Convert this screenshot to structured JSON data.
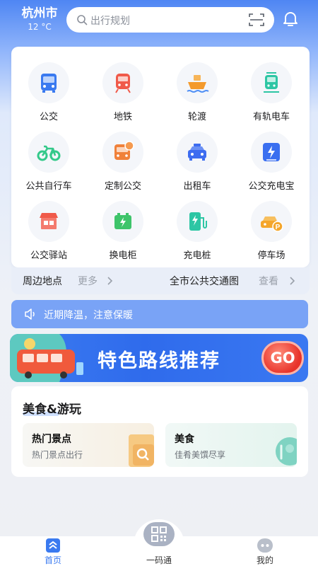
{
  "header": {
    "city": "杭州市",
    "temperature": "12 °C",
    "search_placeholder": "出行规划"
  },
  "grid": [
    {
      "label": "公交",
      "icon": "bus-icon",
      "color": "#3a7af0"
    },
    {
      "label": "地铁",
      "icon": "metro-icon",
      "color": "#f05a4a"
    },
    {
      "label": "轮渡",
      "icon": "ferry-icon",
      "color": "#f49a2c"
    },
    {
      "label": "有轨电车",
      "icon": "tram-icon",
      "color": "#2dc6a4"
    },
    {
      "label": "公共自行车",
      "icon": "bicycle-icon",
      "color": "#34c98a"
    },
    {
      "label": "定制公交",
      "icon": "custom-bus-icon",
      "color": "#f0813a"
    },
    {
      "label": "出租车",
      "icon": "taxi-icon",
      "color": "#3d6cf0"
    },
    {
      "label": "公交充电宝",
      "icon": "power-bank-icon",
      "color": "#3a6ff0"
    },
    {
      "label": "公交驿站",
      "icon": "bus-station-icon",
      "color": "#f05a4a"
    },
    {
      "label": "换电柜",
      "icon": "battery-swap-icon",
      "color": "#3ec46a"
    },
    {
      "label": "充电桩",
      "icon": "charging-pile-icon",
      "color": "#2dc6a4"
    },
    {
      "label": "停车场",
      "icon": "parking-icon",
      "color": "#f4a62c"
    }
  ],
  "nearby": {
    "title": "周边地点",
    "more": "更多",
    "map_title": "全市公共交通图",
    "map_view": "查看"
  },
  "notice": {
    "text": "近期降温，注意保暖"
  },
  "banner": {
    "title": "特色路线推荐",
    "go": "GO"
  },
  "fun": {
    "title": "美食&游玩",
    "tiles": [
      {
        "title": "热门景点",
        "subtitle": "热门景点出行",
        "icon": "ticket-search-icon"
      },
      {
        "title": "美食",
        "subtitle": "佳肴美馔尽享",
        "icon": "food-icon"
      }
    ]
  },
  "bottom_nav": {
    "home": "首页",
    "code": "一码通",
    "mine": "我的",
    "active_color": "#3a7af0"
  }
}
